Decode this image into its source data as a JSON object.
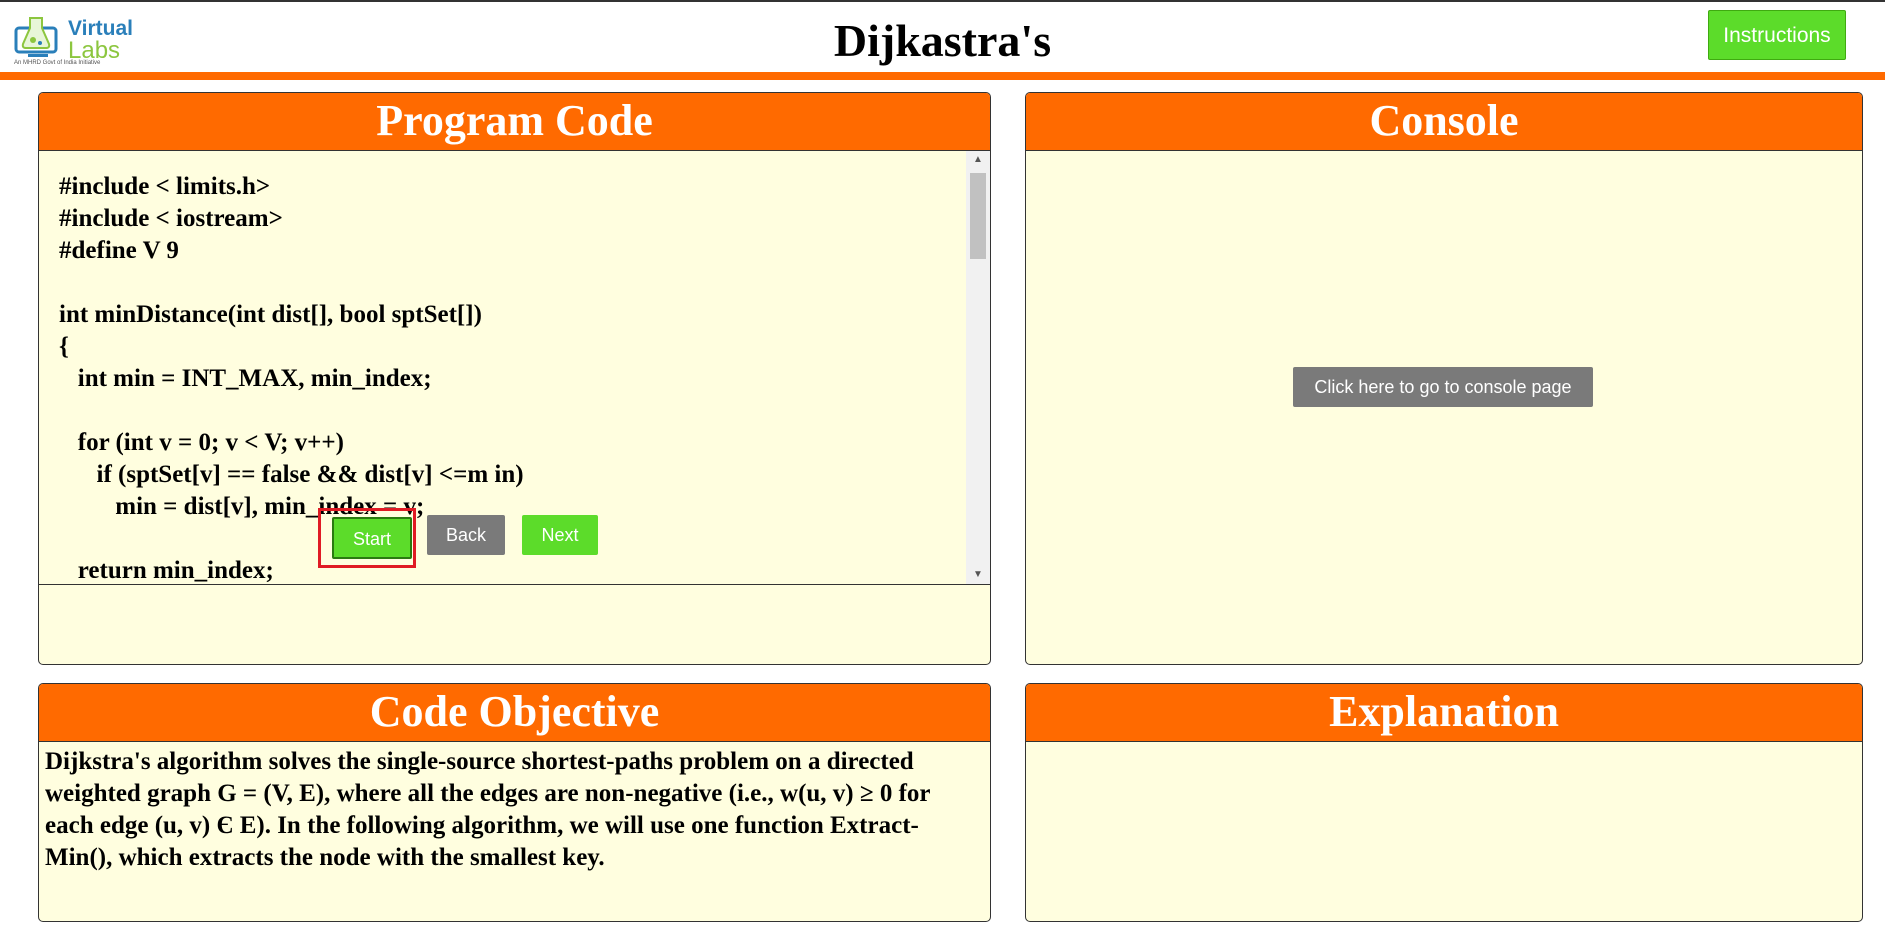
{
  "header": {
    "logo_name": "Virtual",
    "logo_name2": "Labs",
    "logo_tagline": "An MHRD Govt of India Initiative",
    "title": "Dijkastra's",
    "instructions_label": "Instructions"
  },
  "code_panel": {
    "title": "Program Code",
    "lines": [
      "#include < limits.h>",
      "#include < iostream>",
      "#define V 9",
      "",
      "int minDistance(int dist[], bool sptSet[])",
      "{",
      "   int min = INT_MAX, min_index;",
      "",
      "   for (int v = 0; v < V; v++)",
      "      if (sptSet[v] == false && dist[v] <=m in)",
      "         min = dist[v], min_index = v;",
      "",
      "   return min_index;"
    ],
    "buttons": {
      "start": "Start",
      "back": "Back",
      "next": "Next"
    }
  },
  "console_panel": {
    "title": "Console",
    "button_label": "Click here to go to console page"
  },
  "objective_panel": {
    "title": "Code Objective",
    "text": "Dijkstra's algorithm solves the single-source shortest-paths problem on a directed weighted graph G = (V, E), where all the edges are non-negative (i.e., w(u, v) ≥ 0 for each edge (u, v) Є E). In the following algorithm, we will use one function Extract-Min(), which extracts the node with the smallest key."
  },
  "explanation_panel": {
    "title": "Explanation",
    "text": ""
  },
  "colors": {
    "accent": "#ff6a00",
    "panel_bg": "#fffedf",
    "green_button": "#5cdc2a",
    "grey_button": "#7a7a7a",
    "highlight": "#e01b24"
  },
  "icons": [
    "virtual-labs-logo-icon",
    "scroll-up-arrow-icon",
    "scroll-down-arrow-icon"
  ]
}
